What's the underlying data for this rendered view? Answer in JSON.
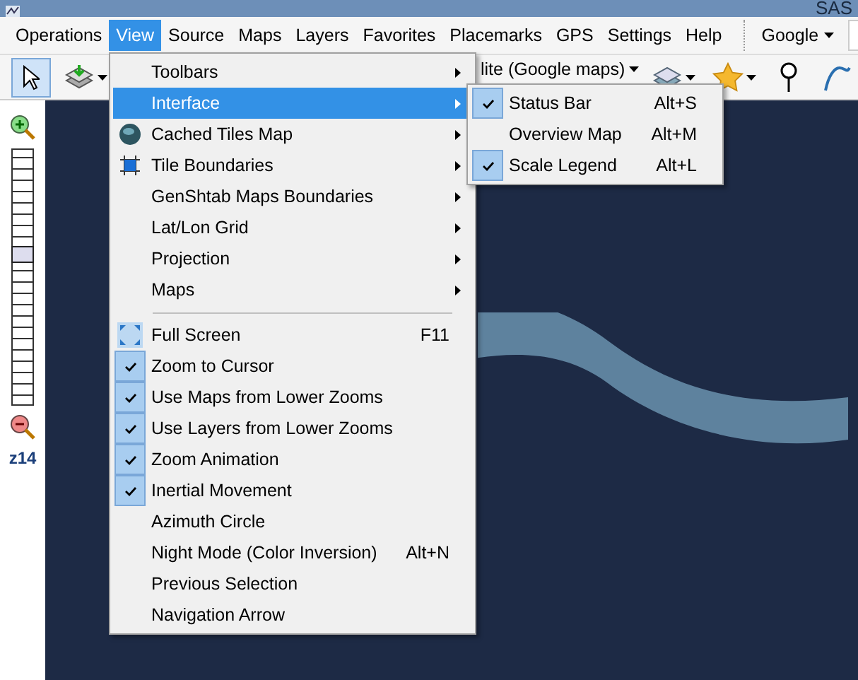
{
  "window": {
    "title": "SAS"
  },
  "menu_bar": [
    {
      "label": "Operations",
      "selected": false
    },
    {
      "label": "View",
      "selected": true
    },
    {
      "label": "Source",
      "selected": false
    },
    {
      "label": "Maps",
      "selected": false
    },
    {
      "label": "Layers",
      "selected": false
    },
    {
      "label": "Favorites",
      "selected": false
    },
    {
      "label": "Placemarks",
      "selected": false
    },
    {
      "label": "GPS",
      "selected": false
    },
    {
      "label": "Settings",
      "selected": false
    },
    {
      "label": "Help",
      "selected": false
    }
  ],
  "search": {
    "engine": "Google"
  },
  "toolbar": {
    "map_source": "lite (Google maps)",
    "select_tool": {
      "selected": true
    }
  },
  "zoom": {
    "level": 0.59,
    "label": "z14"
  },
  "view_menu": [
    {
      "kind": "item",
      "label": "Toolbars",
      "submenu": true,
      "checked": false,
      "selected": false
    },
    {
      "kind": "item",
      "label": "Interface",
      "submenu": true,
      "checked": false,
      "selected": true
    },
    {
      "kind": "item",
      "label": "Cached Tiles Map",
      "submenu": true,
      "checked": false,
      "selected": false
    },
    {
      "kind": "item",
      "label": "Tile Boundaries",
      "submenu": true,
      "checked": false,
      "selected": false
    },
    {
      "kind": "item",
      "label": "GenShtab Maps Boundaries",
      "submenu": true,
      "checked": false,
      "selected": false
    },
    {
      "kind": "item",
      "label": "Lat/Lon Grid",
      "submenu": true,
      "checked": false,
      "selected": false
    },
    {
      "kind": "item",
      "label": "Projection",
      "submenu": true,
      "checked": false,
      "selected": false
    },
    {
      "kind": "item",
      "label": "Maps",
      "submenu": true,
      "checked": false,
      "selected": false
    },
    {
      "kind": "separator"
    },
    {
      "kind": "item",
      "label": "Full Screen",
      "shortcut": "F11",
      "submenu": false,
      "checked": false,
      "selected": false
    },
    {
      "kind": "item",
      "label": "Zoom to Cursor",
      "submenu": false,
      "checked": true,
      "selected": false
    },
    {
      "kind": "item",
      "label": "Use Maps from Lower Zooms",
      "submenu": false,
      "checked": true,
      "selected": false
    },
    {
      "kind": "item",
      "label": "Use Layers from Lower Zooms",
      "submenu": false,
      "checked": true,
      "selected": false
    },
    {
      "kind": "item",
      "label": "Zoom Animation",
      "submenu": false,
      "checked": true,
      "selected": false
    },
    {
      "kind": "item",
      "label": "Inertial Movement",
      "submenu": false,
      "checked": true,
      "selected": false
    },
    {
      "kind": "item",
      "label": "Azimuth Circle",
      "submenu": false,
      "checked": false,
      "selected": false
    },
    {
      "kind": "item",
      "label": "Night Mode (Color Inversion)",
      "shortcut": "Alt+N",
      "submenu": false,
      "checked": false,
      "selected": false
    },
    {
      "kind": "item",
      "label": "Previous Selection",
      "submenu": false,
      "checked": false,
      "selected": false
    },
    {
      "kind": "item",
      "label": "Navigation Arrow",
      "submenu": false,
      "checked": false,
      "selected": false
    }
  ],
  "interface_submenu": [
    {
      "label": "Status Bar",
      "shortcut": "Alt+S",
      "checked": true
    },
    {
      "label": "Overview Map",
      "shortcut": "Alt+M",
      "checked": false
    },
    {
      "label": "Scale Legend",
      "shortcut": "Alt+L",
      "checked": true
    }
  ]
}
